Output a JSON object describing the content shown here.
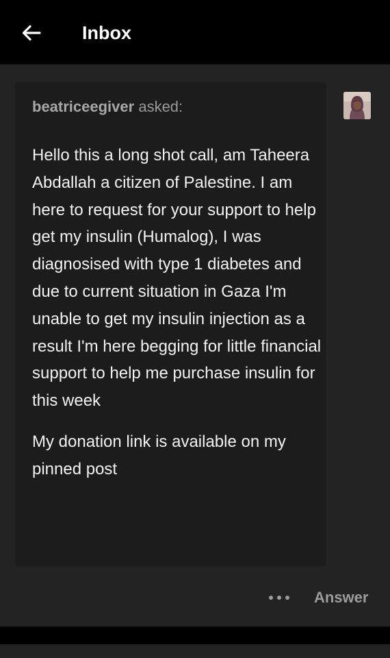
{
  "header": {
    "back_icon": "arrow-left-icon",
    "title": "Inbox"
  },
  "ask": {
    "asker": "beatriceegiver",
    "asked_label": "asked:",
    "paragraphs": [
      "Hello this a long shot call, am Taheera Abdallah a citizen of Palestine. I am here to request for your support to help get my insulin (Humalog), I was diagnosised with type 1 diabetes and due to current situation in Gaza I'm unable to get my insulin injection as a result I'm here begging for little financial support to help me purchase insulin for this week",
      "My donation link is available on my pinned post"
    ],
    "avatar_icon": "user-avatar"
  },
  "actions": {
    "more_icon": "more-dots-icon",
    "answer_label": "Answer"
  },
  "colors": {
    "background": "#000000",
    "panel": "#232323",
    "bubble": "#1c1c1c",
    "text_primary": "#f2f2f2",
    "text_muted": "#9a9a9a"
  }
}
